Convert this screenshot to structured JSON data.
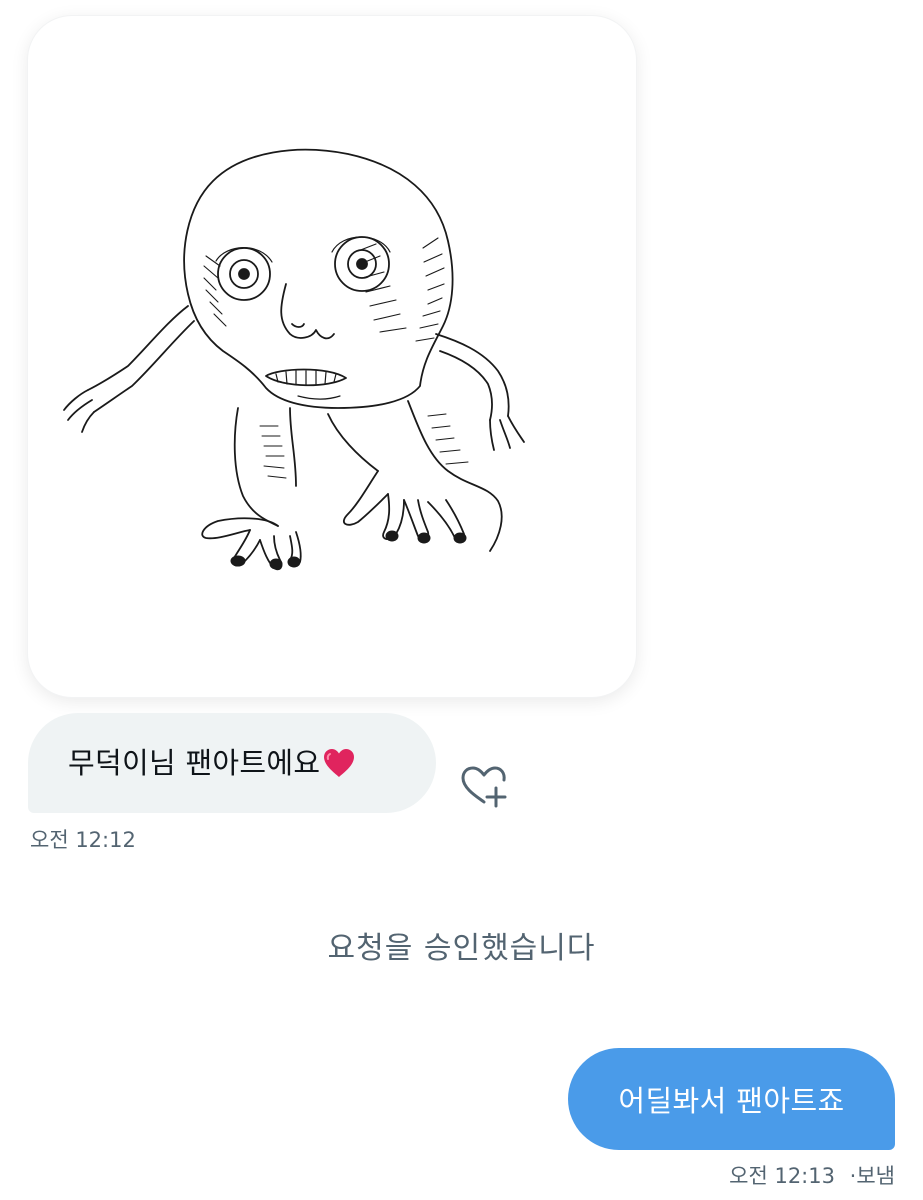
{
  "conversation": {
    "image_message": {
      "image": "hand-drawn-sketch-bald-creature"
    },
    "received_message": {
      "text": "무덕이님 팬아트에요",
      "emoji": "❤️",
      "time": "오전 12:12",
      "react_icon": "heart-plus-icon"
    },
    "system_message": "요청을 승인했습니다",
    "sent_message": {
      "text": "어딜봐서 팬아트죠",
      "time": "오전 12:13",
      "status": "보냄",
      "separator": "·"
    }
  },
  "colors": {
    "sent_bubble": "#4a9be9",
    "received_bubble": "#eff3f4",
    "secondary_text": "#536471",
    "primary_text": "#0f1419",
    "heart": "#e0245e"
  }
}
